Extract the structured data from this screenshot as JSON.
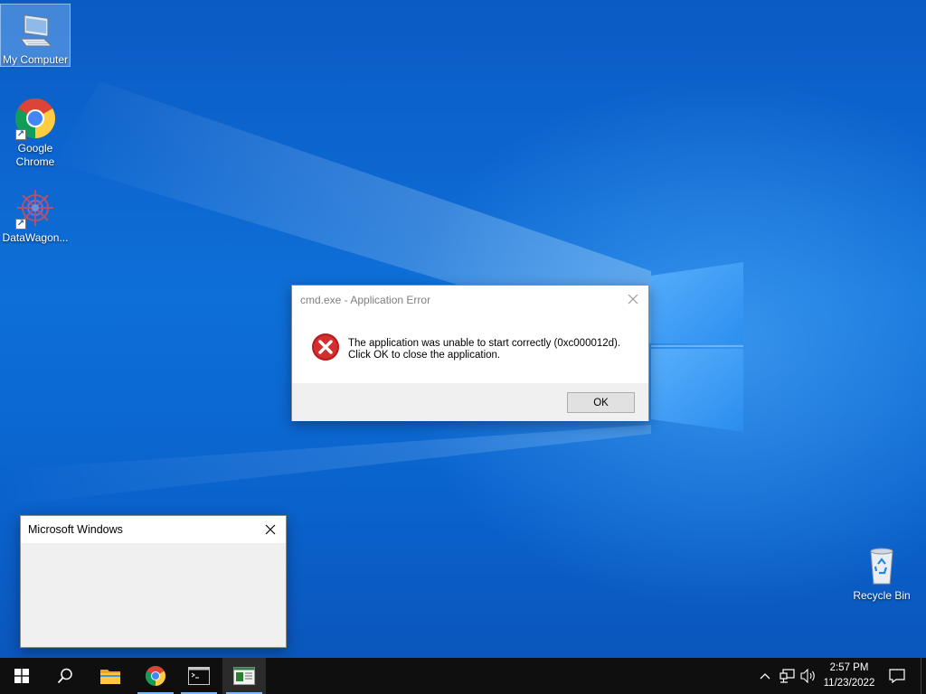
{
  "desktop": {
    "icons": [
      {
        "label": "My Computer",
        "icon": "computer-icon"
      },
      {
        "label": "Google Chrome",
        "label_line1": "Google",
        "label_line2": "Chrome",
        "icon": "chrome-icon"
      },
      {
        "label": "DataWagon...",
        "icon": "datawagon-icon"
      },
      {
        "label": "Recycle Bin",
        "icon": "recycle-bin-icon"
      }
    ]
  },
  "error_dialog": {
    "title": "cmd.exe - Application Error",
    "message_line1": "The application was unable to start correctly (0xc000012d).",
    "message_line2": "Click OK to close the application.",
    "ok_label": "OK",
    "icon": "error-icon"
  },
  "ms_dialog": {
    "title": "Microsoft Windows"
  },
  "taskbar": {
    "buttons": [
      "start-icon",
      "search-icon",
      "file-explorer-icon",
      "chrome-icon",
      "cmd-icon",
      "app-window-icon"
    ],
    "tray": [
      "chevron-up-icon",
      "network-icon",
      "volume-icon"
    ],
    "time": "2:57 PM",
    "date": "11/23/2022",
    "notification_icon": "notification-icon"
  },
  "colors": {
    "wallpaper": "#0a63c9",
    "taskbar": "#0f0f10",
    "error_red": "#c42b1c"
  }
}
